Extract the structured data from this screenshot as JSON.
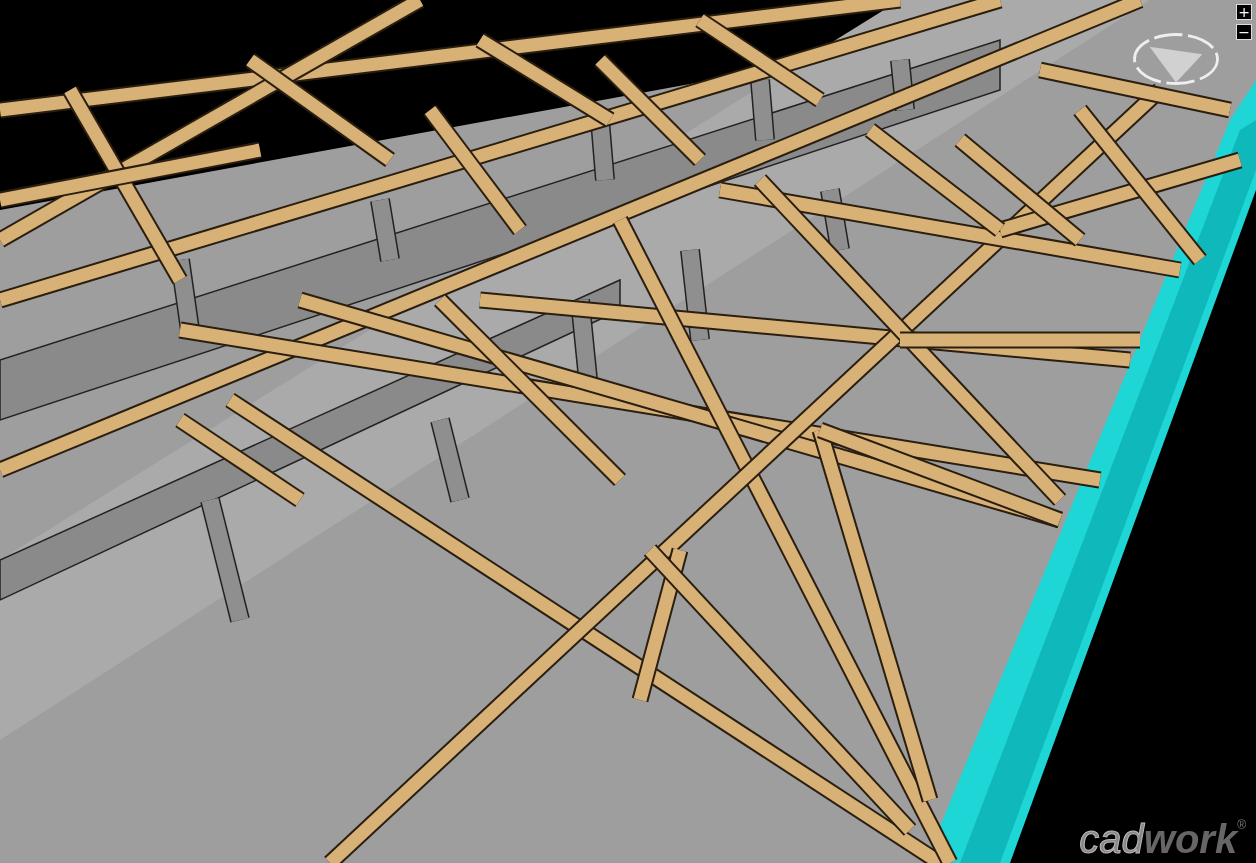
{
  "viewport": {
    "zoom_in": "+",
    "zoom_out": "−"
  },
  "logo": {
    "outlined": "cad",
    "bold": "work",
    "mark": "®"
  }
}
